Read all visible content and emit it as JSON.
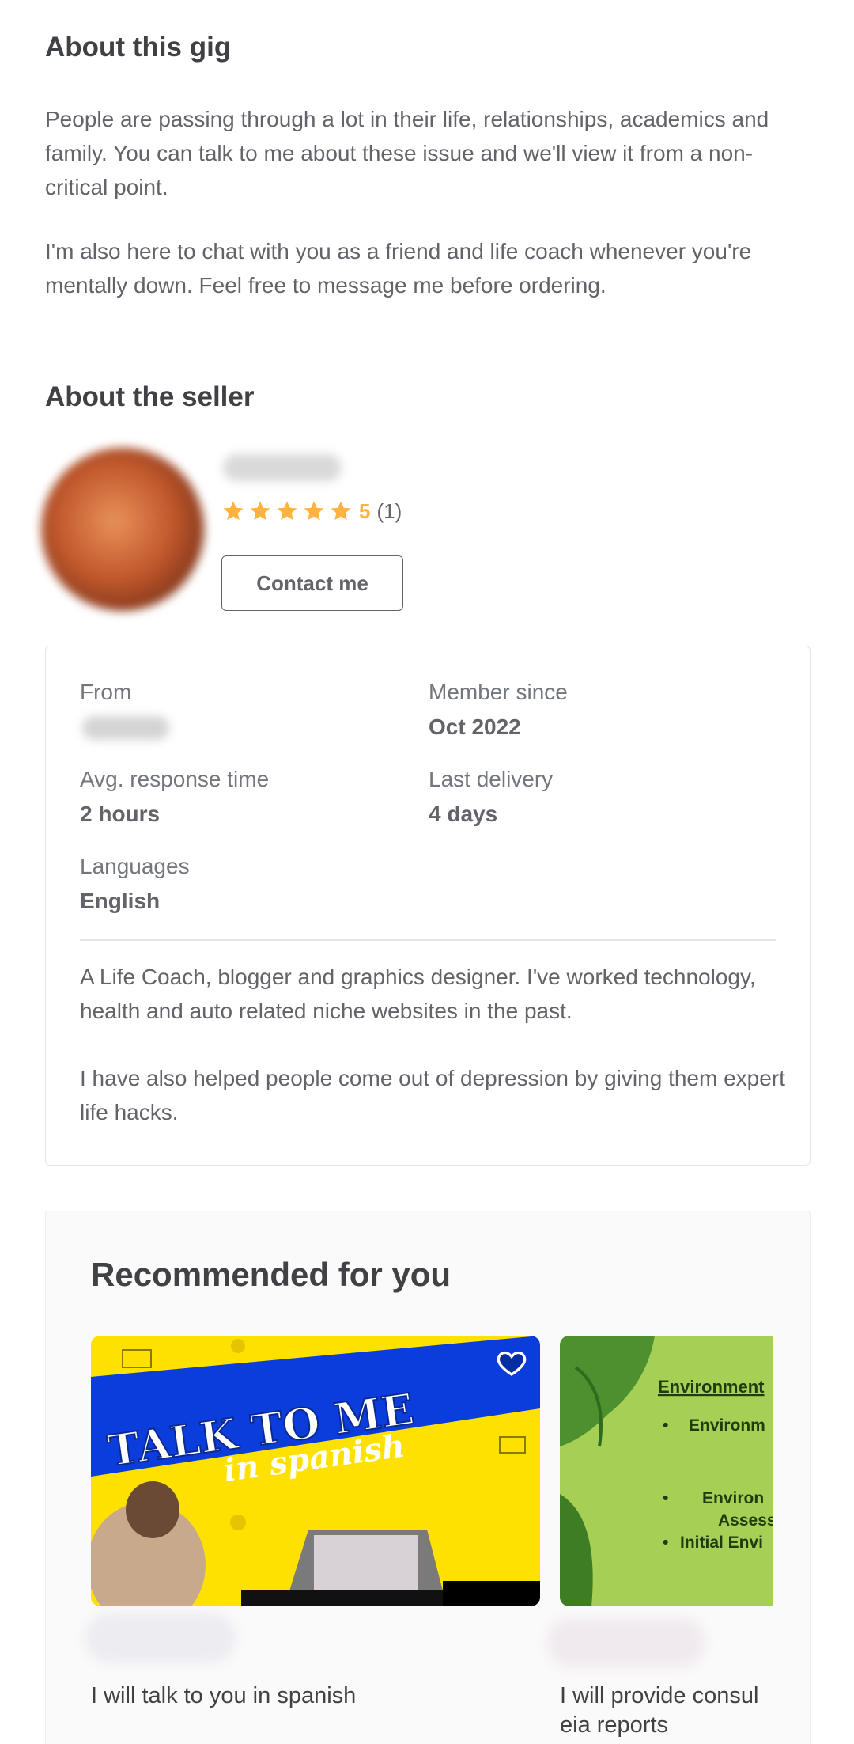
{
  "about_gig": {
    "title": "About this gig",
    "paragraph1": "People are passing through a lot in their life, relationships, academics and family. You can talk to me about these issue and we'll view it from a non-critical point.",
    "paragraph2": "I'm also here to chat with you as a friend and life coach whenever you're mentally down. Feel free to message me before ordering."
  },
  "about_seller": {
    "title": "About the seller",
    "rating_value": "5",
    "rating_count": "(1)",
    "stars": 5,
    "contact_label": "Contact me"
  },
  "stats": {
    "from_label": "From",
    "member_since_label": "Member since",
    "member_since_value": "Oct 2022",
    "response_label": "Avg. response time",
    "response_value": "2 hours",
    "last_delivery_label": "Last delivery",
    "last_delivery_value": "4 days",
    "languages_label": "Languages",
    "languages_value": "English",
    "desc1": "A Life Coach, blogger and graphics designer. I've worked technology, health and auto related niche websites in the past.",
    "desc2": "I have also helped people come out of depression by giving them expert life hacks."
  },
  "recommended": {
    "title": "Recommended for you",
    "card1": {
      "image_line1": "TALK TO ME",
      "image_line2": "in spanish",
      "title": "I will talk to you in spanish"
    },
    "card2": {
      "image_heading": "Environment",
      "bullet1": "Environm",
      "bullet2": "Environ",
      "bullet2b": "Assess",
      "bullet3": "Initial Envi",
      "title_line1": "I will provide consul",
      "title_line2": "eia reports"
    }
  },
  "colors": {
    "star": "#ffb33e",
    "text_dark": "#404145",
    "text_muted": "#62646a",
    "border": "#e4e5e7"
  }
}
